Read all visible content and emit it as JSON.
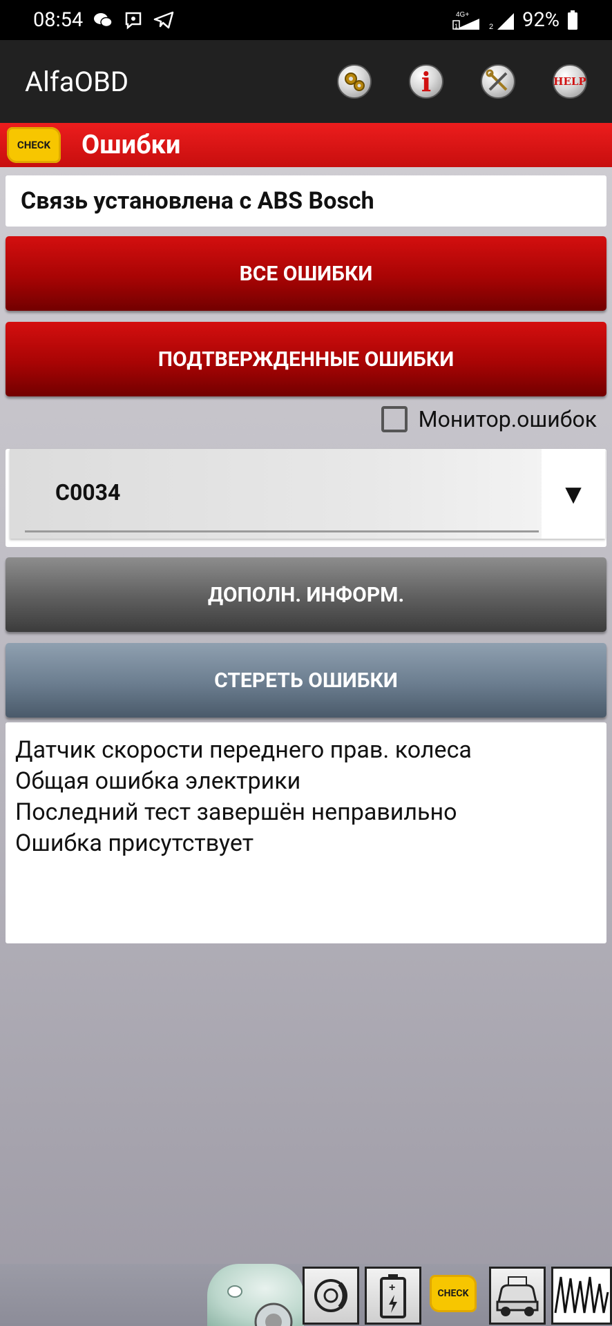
{
  "status_bar": {
    "time": "08:54",
    "network": "4G+",
    "sim1": "1",
    "sim2": "2",
    "battery": "92%"
  },
  "app_bar": {
    "title": "AlfaOBD",
    "actions": [
      {
        "name": "settings",
        "icon": "gears-icon"
      },
      {
        "name": "info",
        "icon": "info-icon",
        "label": "i"
      },
      {
        "name": "tools",
        "icon": "tools-icon"
      },
      {
        "name": "help",
        "icon": "help-icon",
        "label": "HELP"
      }
    ]
  },
  "section": {
    "badge": "CHECK",
    "title": "Ошибки"
  },
  "connection_text": "Связь установлена с ABS Bosch",
  "buttons": {
    "all_errors": "ВСЕ ОШИБКИ",
    "confirmed_errors": "ПОДТВЕРЖДЕННЫЕ ОШИБКИ",
    "more_info": "ДОПОЛН. ИНФОРМ.",
    "clear_errors": "СТЕРЕТЬ ОШИБКИ"
  },
  "monitor": {
    "label": "Монитор.ошибок",
    "checked": false
  },
  "dtc_selector": {
    "selected": "C0034",
    "arrow": "▼"
  },
  "description_lines": [
    "Датчик скорости переднего прав. колеса",
    "Общая ошибка электрики",
    "Последний тест завершён неправильно",
    "Ошибка присутствует"
  ],
  "bottom_bar": {
    "check_label": "CHECK",
    "items": [
      "car-thumb-icon",
      "brake-disc-icon",
      "battery-icon",
      "check-engine-icon",
      "car-service-icon",
      "oscillogram-icon"
    ]
  },
  "colors": {
    "header_red": "#d81414",
    "button_red": "#a80404",
    "button_grey": "#5e5e5e",
    "button_slate": "#6b7d8f",
    "check_yellow": "#f7c600"
  }
}
